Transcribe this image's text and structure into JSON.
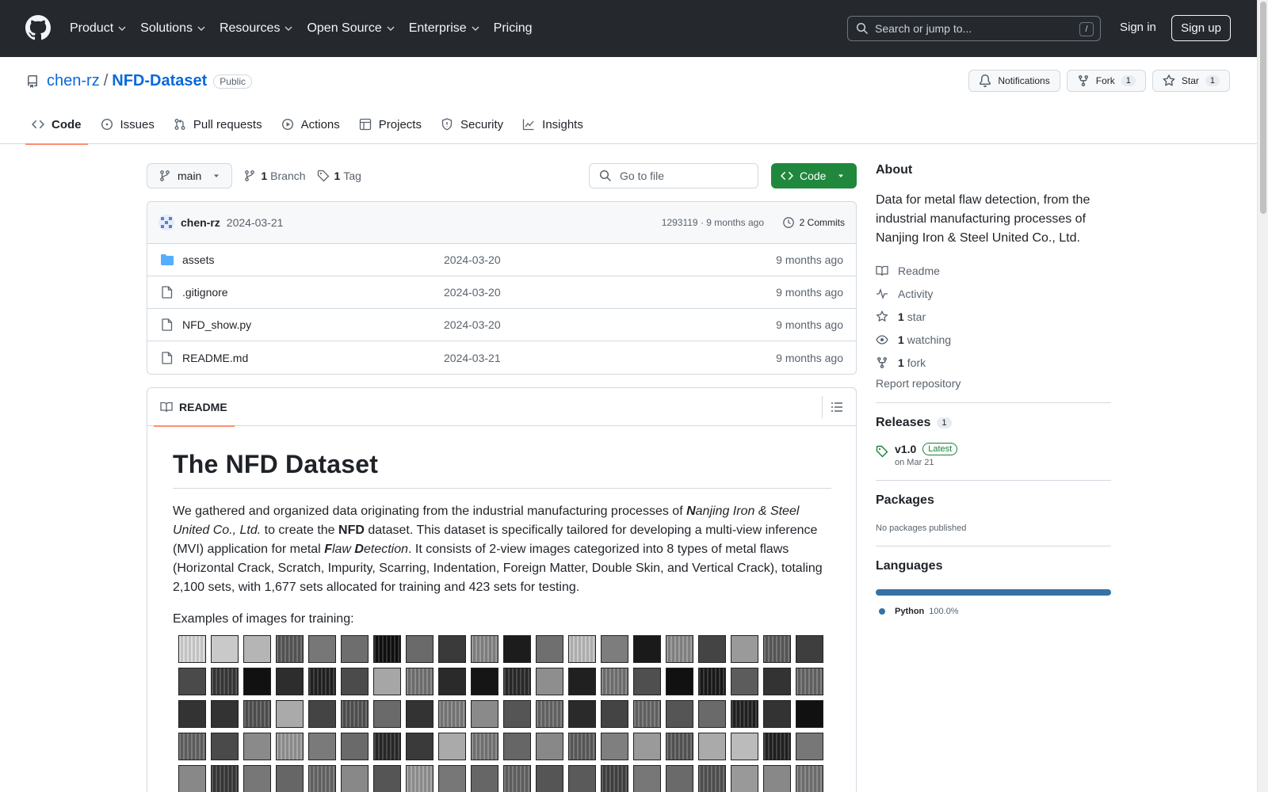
{
  "header": {
    "nav": [
      {
        "label": "Product",
        "dropdown": true
      },
      {
        "label": "Solutions",
        "dropdown": true
      },
      {
        "label": "Resources",
        "dropdown": true
      },
      {
        "label": "Open Source",
        "dropdown": true
      },
      {
        "label": "Enterprise",
        "dropdown": true
      },
      {
        "label": "Pricing",
        "dropdown": false
      }
    ],
    "search_placeholder": "Search or jump to...",
    "search_shortcut": "/",
    "signin": "Sign in",
    "signup": "Sign up"
  },
  "repo": {
    "owner": "chen-rz",
    "separator": "/",
    "name": "NFD-Dataset",
    "visibility": "Public",
    "notifications_label": "Notifications",
    "fork_label": "Fork",
    "fork_count": "1",
    "star_label": "Star",
    "star_count": "1",
    "tabs": [
      {
        "label": "Code",
        "icon": "code-icon",
        "active": true
      },
      {
        "label": "Issues",
        "icon": "issue-icon"
      },
      {
        "label": "Pull requests",
        "icon": "pull-request-icon"
      },
      {
        "label": "Actions",
        "icon": "play-icon"
      },
      {
        "label": "Projects",
        "icon": "table-icon"
      },
      {
        "label": "Security",
        "icon": "shield-icon"
      },
      {
        "label": "Insights",
        "icon": "graph-icon"
      }
    ]
  },
  "toolbar": {
    "branch": "main",
    "branch_count": "1",
    "branch_label": "Branch",
    "tag_count": "1",
    "tag_label": "Tag",
    "goto_placeholder": "Go to file",
    "code_button": "Code"
  },
  "commit": {
    "author": "chen-rz",
    "date": "2024-03-21",
    "hash_info": "1293119 · 9 months ago",
    "commits_label": "2 Commits"
  },
  "files": [
    {
      "name": "assets",
      "type": "folder",
      "date": "2024-03-20",
      "age": "9 months ago"
    },
    {
      "name": ".gitignore",
      "type": "file",
      "date": "2024-03-20",
      "age": "9 months ago"
    },
    {
      "name": "NFD_show.py",
      "type": "file",
      "date": "2024-03-20",
      "age": "9 months ago"
    },
    {
      "name": "README.md",
      "type": "file",
      "date": "2024-03-21",
      "age": "9 months ago"
    }
  ],
  "readme": {
    "tab_label": "README",
    "title": "The NFD Dataset",
    "p1": {
      "a": "We gathered and organized data originating from the industrial manufacturing processes of ",
      "n_bold": "N",
      "n_rest": "anjing Iron & Steel United Co., Ltd.",
      "b": " to create the ",
      "nfd": "NFD",
      "c": " dataset. This dataset is specifically tailored for developing a multi-view inference (MVI) application for metal ",
      "f_bold": "F",
      "f_rest": "law ",
      "d_bold": "D",
      "d_rest": "etection",
      "d": ". It consists of 2-view images categorized into 8 types of metal flaws (Horizontal Crack, Scratch, Impurity, Scarring, Indentation, Foreign Matter, Double Skin, and Vertical Crack), totaling 2,100 sets, with 1,677 sets allocated for training and 423 sets for testing."
    },
    "examples_label": "Examples of images for training:",
    "thumb_shades": [
      "#d8d8d8",
      "#c9c9c9",
      "#b5b5b5",
      "#5a5a5a",
      "#777",
      "#6e6e6e",
      "#0f0f0f",
      "#6a6a6a",
      "#3a3a3a",
      "#8a8a8a",
      "#1c1c1c",
      "#6f6f6f",
      "#c0c0c0",
      "#7d7d7d",
      "#1a1a1a",
      "#8d8d8d",
      "#444",
      "#9a9a9a",
      "#5e5e5e",
      "#3e3e3e",
      "#4a4a4a",
      "#3a3a3a",
      "#111",
      "#2d2d2d",
      "#222",
      "#4b4b4b",
      "#a6a6a6",
      "#777",
      "#2a2a2a",
      "#151515",
      "#2b2b2b",
      "#8e8e8e",
      "#202020",
      "#777",
      "#4f4f4f",
      "#111",
      "#1a1a1a",
      "#5c5c5c",
      "#333",
      "#6a6a6a",
      "#333",
      "#333",
      "#555",
      "#aaa",
      "#444",
      "#555",
      "#6a6a6a",
      "#333",
      "#7f7f7f",
      "#8a8a8a",
      "#555",
      "#6b6b6b",
      "#2a2a2a",
      "#444",
      "#6a6a6a",
      "#555",
      "#6a6a6a",
      "#222",
      "#333",
      "#111",
      "#666",
      "#4a4a4a",
      "#8a8a8a",
      "#999",
      "#7a7a7a",
      "#6a6a6a",
      "#2a2a2a",
      "#3a3a3a",
      "#aaa",
      "#7a7a7a",
      "#666",
      "#888",
      "#5f5f5f",
      "#7f7f7f",
      "#9a9a9a",
      "#5a5a5a",
      "#aaa",
      "#bbb",
      "#222",
      "#777",
      "#888",
      "#3a3a3a",
      "#777",
      "#666",
      "#6a6a6a",
      "#888",
      "#555",
      "#999",
      "#777",
      "#666",
      "#666",
      "#555",
      "#5a5a5a",
      "#444",
      "#777",
      "#6a6a6a",
      "#555",
      "#999",
      "#888",
      "#777"
    ]
  },
  "about": {
    "heading": "About",
    "description": "Data for metal flaw detection, from the industrial manufacturing processes of Nanjing Iron & Steel United Co., Ltd.",
    "readme": "Readme",
    "activity": "Activity",
    "stars_count": "1",
    "stars_label": "star",
    "watching_count": "1",
    "watching_label": "watching",
    "forks_count": "1",
    "forks_label": "fork",
    "report": "Report repository"
  },
  "releases": {
    "heading": "Releases",
    "count": "1",
    "version": "v1.0",
    "latest": "Latest",
    "date": "on Mar 21"
  },
  "packages": {
    "heading": "Packages",
    "none": "No packages published"
  },
  "languages": {
    "heading": "Languages",
    "name": "Python",
    "percent": "100.0%",
    "color": "#3572A5"
  }
}
